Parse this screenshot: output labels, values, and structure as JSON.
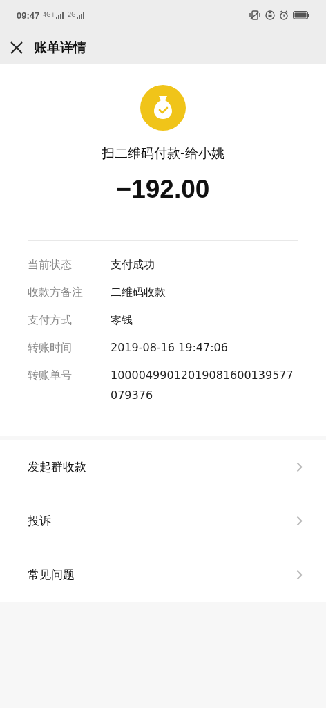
{
  "status_bar": {
    "time": "09:47",
    "network_1": "4G+",
    "network_2": "2G"
  },
  "header": {
    "title": "账单详情"
  },
  "summary": {
    "title": "扫二维码付款-给小姚",
    "amount": "−192.00"
  },
  "details": [
    {
      "label": "当前状态",
      "value": "支付成功"
    },
    {
      "label": "收款方备注",
      "value": "二维码收款"
    },
    {
      "label": "支付方式",
      "value": "零钱"
    },
    {
      "label": "转账时间",
      "value": "2019-08-16 19:47:06"
    },
    {
      "label": "转账单号",
      "value": "10000499012019081600139577079376"
    }
  ],
  "menu": [
    {
      "label": "发起群收款"
    },
    {
      "label": "投诉"
    },
    {
      "label": "常见问题"
    }
  ]
}
